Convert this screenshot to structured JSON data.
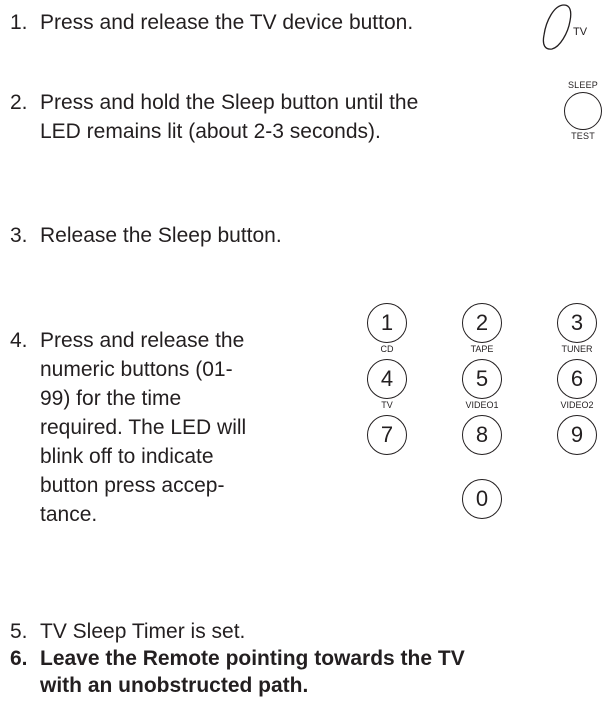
{
  "steps": [
    {
      "num": "1.",
      "line1": "Press and release the TV device button."
    },
    {
      "num": "2.",
      "line1": "Press and hold the Sleep button until the",
      "line2": "LED remains lit (about 2-3 seconds)."
    },
    {
      "num": "3.",
      "line1": "Release the Sleep button."
    },
    {
      "num": "4.",
      "lines": [
        "Press and release the",
        "numeric buttons (01-",
        "99) for the time",
        "required. The LED will",
        "blink off to indicate",
        "button press accep-",
        "tance."
      ]
    },
    {
      "num": "5.",
      "line1": "TV Sleep Timer is set."
    },
    {
      "num": "6.",
      "line1": "Leave the Remote pointing towards the TV",
      "line2": "with an unobstructed path."
    }
  ],
  "tv_button": {
    "label": "TV"
  },
  "sleep_button": {
    "top_label": "SLEEP",
    "bottom_label": "TEST"
  },
  "keypad": {
    "keys": [
      {
        "digit": "1",
        "sub": "CD"
      },
      {
        "digit": "2",
        "sub": "TAPE"
      },
      {
        "digit": "3",
        "sub": "TUNER"
      },
      {
        "digit": "4",
        "sub": "TV"
      },
      {
        "digit": "5",
        "sub": "VIDEO1"
      },
      {
        "digit": "6",
        "sub": "VIDEO2"
      },
      {
        "digit": "7",
        "sub": ""
      },
      {
        "digit": "8",
        "sub": ""
      },
      {
        "digit": "9",
        "sub": ""
      },
      {
        "digit": "0",
        "sub": ""
      }
    ]
  }
}
